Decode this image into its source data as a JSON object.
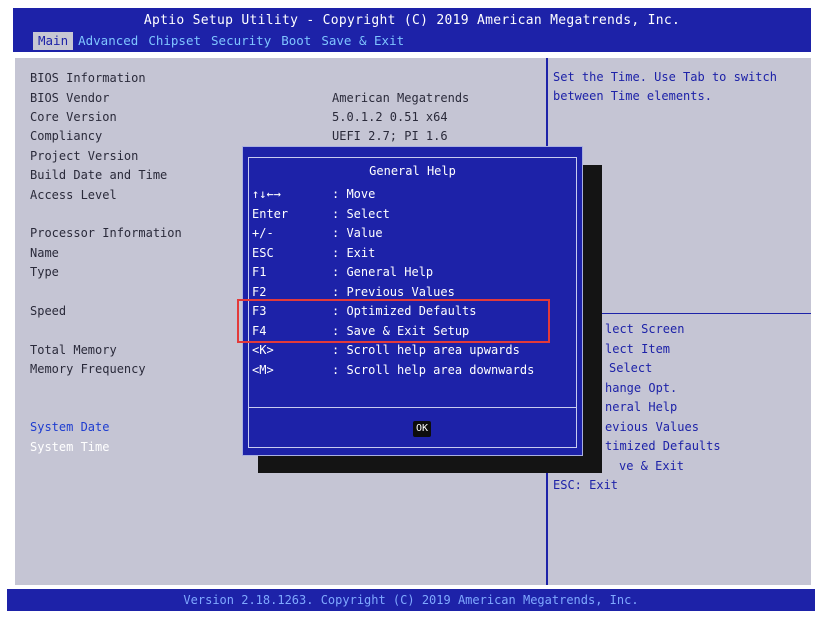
{
  "header": {
    "title": "Aptio Setup Utility - Copyright (C) 2019 American Megatrends, Inc.",
    "tabs": [
      {
        "label": "Main",
        "active": true
      },
      {
        "label": "Advanced",
        "active": false
      },
      {
        "label": "Chipset",
        "active": false
      },
      {
        "label": "Security",
        "active": false
      },
      {
        "label": "Boot",
        "active": false
      },
      {
        "label": "Save & Exit",
        "active": false
      }
    ]
  },
  "left": {
    "rows": [
      {
        "label": "BIOS Information",
        "value": ""
      },
      {
        "label": "BIOS Vendor",
        "value": "American Megatrends"
      },
      {
        "label": "Core Version",
        "value": "5.0.1.2  0.51 x64"
      },
      {
        "label": "Compliancy",
        "value": "UEFI 2.7; PI 1.6"
      },
      {
        "label": "Project Version",
        "value": ""
      },
      {
        "label": "Build Date and Time",
        "value": ""
      },
      {
        "label": "Access Level",
        "value": ""
      },
      {
        "label": "Processor Information",
        "value": ""
      },
      {
        "label": "Name",
        "value": ""
      },
      {
        "label": "Type",
        "value": ""
      },
      {
        "label": "Speed",
        "value": ""
      },
      {
        "label": "Total Memory",
        "value": ""
      },
      {
        "label": "Memory Frequency",
        "value": ""
      },
      {
        "label": "System Date",
        "value": ""
      },
      {
        "label": "System Time",
        "value": ""
      }
    ]
  },
  "right": {
    "help_text": "Set the Time. Use Tab to switch between Time elements.",
    "key_hints": [
      "lect Screen",
      "lect Item",
      "Select",
      "hange Opt.",
      "neral Help",
      "evious Values",
      "timized Defaults",
      "ve & Exit",
      "ESC: Exit"
    ]
  },
  "dialog": {
    "title": "General Help",
    "items": [
      {
        "key": "↑↓←→",
        "desc": ": Move"
      },
      {
        "key": "Enter",
        "desc": ": Select"
      },
      {
        "key": "+/-",
        "desc": ": Value"
      },
      {
        "key": "ESC",
        "desc": ": Exit"
      },
      {
        "key": "F1",
        "desc": ": General Help"
      },
      {
        "key": "F2",
        "desc": ": Previous Values"
      },
      {
        "key": "F3",
        "desc": ": Optimized Defaults"
      },
      {
        "key": "F4",
        "desc": ": Save & Exit Setup"
      },
      {
        "key": "<K>",
        "desc": ": Scroll help area upwards"
      },
      {
        "key": "<M>",
        "desc": ": Scroll help area downwards"
      }
    ],
    "ok_label": "OK"
  },
  "footer": {
    "text": "Version 2.18.1263. Copyright (C) 2019 American Megatrends, Inc."
  },
  "colors": {
    "bios_blue": "#1d22a8",
    "panel_gray": "#c5c5d4",
    "tab_text": "#7fc5ff",
    "highlight_red": "#e33a3a"
  }
}
